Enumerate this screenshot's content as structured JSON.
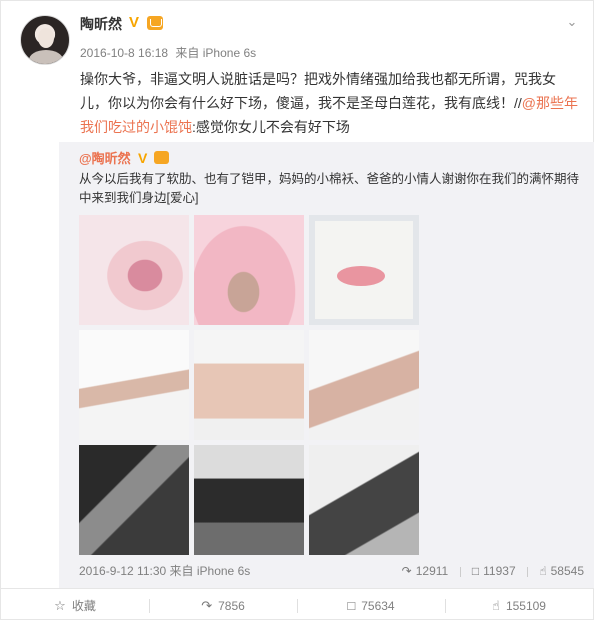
{
  "post": {
    "user_name": "陶昕然",
    "verified_icon": "verified-badge-icon",
    "vip_icon": "vip-crown-icon",
    "time": "2016-10-8 16:18",
    "source": "来自 iPhone 6s",
    "text_part1": "操你大爷，非逼文明人说脏话是吗？把戏外情绪强加给我也都无所谓，咒我女儿，你以为你会有什么好下场，傻逼，我不是圣母白莲花，我有底线！//",
    "mention": "@那些年我们吃过的小馄饨",
    "text_part2": ":感觉你女儿不会有好下场"
  },
  "repost": {
    "user_name": "@陶昕然",
    "text": "从今以后我有了软肋、也有了铠甲，妈妈的小棉袄、爸爸的小情人谢谢你在我们的满怀期待中来到我们身边[爱心]",
    "time": "2016-9-12 11:30",
    "source": "来自 iPhone 6s",
    "reposts": "12911",
    "comments": "11937",
    "likes": "58545",
    "images": [
      "baby-hand-photo",
      "baby-pink-clothes-photo",
      "baby-footprint-photo",
      "couple-maternity-photo-1",
      "couple-maternity-photo-2",
      "couple-maternity-photo-3",
      "bw-maternity-photo-1",
      "bw-maternity-photo-2",
      "bw-maternity-photo-3"
    ]
  },
  "actions": {
    "favorite_label": "收藏",
    "repost_count": "7856",
    "comment_count": "75634",
    "like_count": "155109"
  },
  "colors": {
    "accent_orange": "#eb7350",
    "link_blue": "#4a90c0",
    "repost_bg": "#f2f2f5",
    "verified_gold": "#f7a500"
  }
}
